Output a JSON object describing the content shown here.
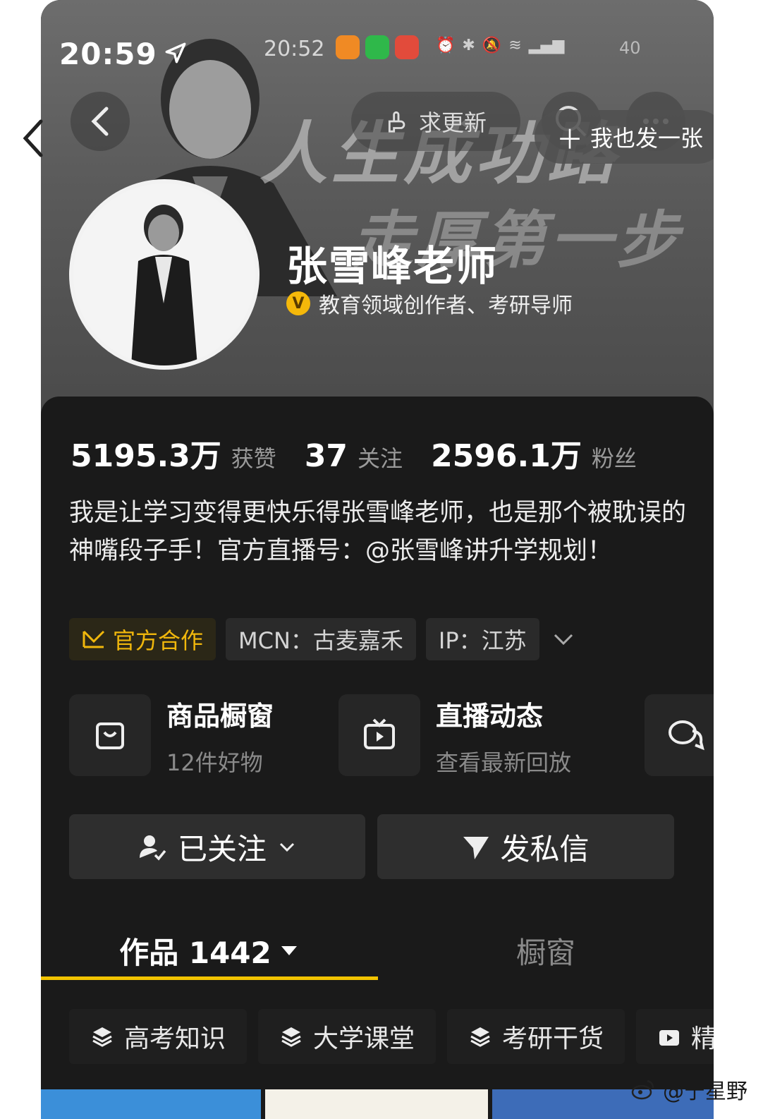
{
  "outer_status": {
    "time": "20:59"
  },
  "inner_status": {
    "time": "20:52",
    "battery": "40"
  },
  "banner": {
    "headline_1": "人生成功路",
    "headline_2": "走厚第一步"
  },
  "top_actions": {
    "request_update": "求更新",
    "post_one": "我也发一张"
  },
  "profile": {
    "name": "张雪峰老师",
    "verification": "教育领域创作者、考研导师",
    "verify_badge": "V"
  },
  "stats": [
    {
      "value": "5195.3万",
      "label": "获赞"
    },
    {
      "value": "37",
      "label": "关注"
    },
    {
      "value": "2596.1万",
      "label": "粉丝"
    }
  ],
  "bio": "我是让学习变得更快乐得张雪峰老师，也是那个被耽误的神嘴段子手！官方直播号：@张雪峰讲升学规划！",
  "tags": {
    "official": "官方合作",
    "mcn": "MCN：古麦嘉禾",
    "ip": "IP：江苏"
  },
  "feature_cards": [
    {
      "title": "商品橱窗",
      "subtitle": "12件好物",
      "icon": "shopping-bag-icon"
    },
    {
      "title": "直播动态",
      "subtitle": "查看最新回放",
      "icon": "tv-play-icon"
    },
    {
      "title": "",
      "subtitle": "",
      "icon": "chat-bubbles-icon"
    }
  ],
  "actions": {
    "following": "已关注",
    "message": "发私信"
  },
  "tabs": {
    "works": "作品 1442",
    "showcase": "橱窗"
  },
  "categories": [
    {
      "label": "高考知识",
      "icon": "layers-icon"
    },
    {
      "label": "大学课堂",
      "icon": "layers-icon"
    },
    {
      "label": "考研干货",
      "icon": "layers-icon"
    },
    {
      "label": "精",
      "icon": "video-icon"
    }
  ],
  "watermark": "@宁星野",
  "colors": {
    "accent_yellow": "#f2c300",
    "verify_gold": "#f5b80a",
    "panel_bg": "#1a1a1a"
  }
}
